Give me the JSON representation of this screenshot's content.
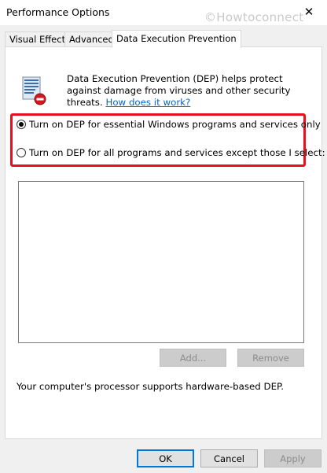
{
  "window": {
    "title": "Performance Options",
    "close_glyph": "✕",
    "watermark": "©Howtoconnect"
  },
  "tabs": [
    {
      "label": "Visual Effects"
    },
    {
      "label": "Advanced"
    },
    {
      "label": "Data Execution Prevention",
      "active": true
    }
  ],
  "dep": {
    "icon": "dep-shield-icon",
    "description": "Data Execution Prevention (DEP) helps protect against damage from viruses and other security threats.",
    "link_text": "How does it work?",
    "options": [
      {
        "label": "Turn on DEP for essential Windows programs and services only",
        "checked": true
      },
      {
        "label": "Turn on DEP for all programs and services except those I select:",
        "checked": false
      }
    ],
    "add_label": "Add...",
    "remove_label": "Remove",
    "status_text": "Your computer's processor supports hardware-based DEP."
  },
  "buttons": {
    "ok": "OK",
    "cancel": "Cancel",
    "apply": "Apply"
  },
  "colors": {
    "highlight": "#e8101c",
    "link": "#0066cc",
    "accent": "#0078d7"
  }
}
